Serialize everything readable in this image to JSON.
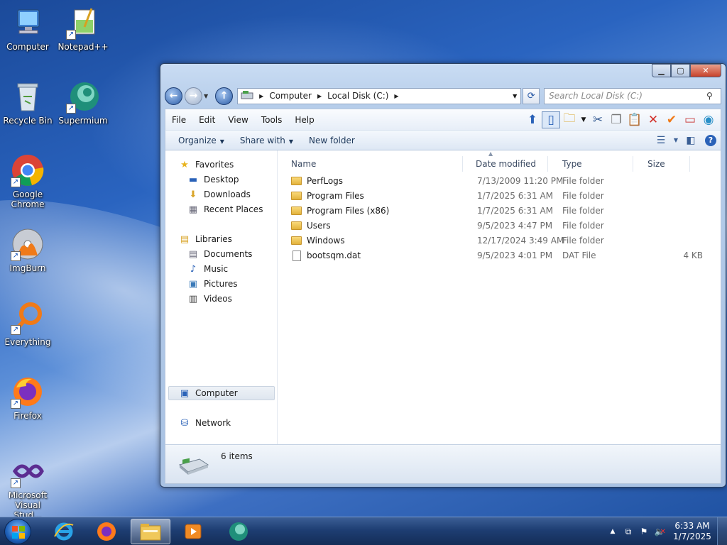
{
  "desktop": {
    "icons": [
      {
        "label": "Computer",
        "icon": "computer-icon"
      },
      {
        "label": "Notepad++",
        "icon": "notepadpp-icon"
      },
      {
        "label": "Recycle Bin",
        "icon": "recycle-bin-icon"
      },
      {
        "label": "Supermium",
        "icon": "supermium-icon"
      },
      {
        "label": "Google Chrome",
        "icon": "chrome-icon"
      },
      {
        "label": "ImgBurn",
        "icon": "imgburn-icon"
      },
      {
        "label": "Everything",
        "icon": "everything-icon"
      },
      {
        "label": "Firefox",
        "icon": "firefox-icon"
      },
      {
        "label": "Microsoft Visual Stud...",
        "icon": "visual-studio-icon"
      }
    ]
  },
  "explorer": {
    "address": {
      "crumbs": [
        "Computer",
        "Local Disk (C:)"
      ]
    },
    "search": {
      "placeholder": "Search Local Disk (C:)"
    },
    "menu": [
      "File",
      "Edit",
      "View",
      "Tools",
      "Help"
    ],
    "commands": {
      "organize": "Organize",
      "share_with": "Share with",
      "new_folder": "New folder"
    },
    "nav": {
      "favorites": "Favorites",
      "favorites_items": [
        "Desktop",
        "Downloads",
        "Recent Places"
      ],
      "libraries": "Libraries",
      "libraries_items": [
        "Documents",
        "Music",
        "Pictures",
        "Videos"
      ],
      "computer": "Computer",
      "network": "Network"
    },
    "columns": {
      "name": "Name",
      "date": "Date modified",
      "type": "Type",
      "size": "Size"
    },
    "files": [
      {
        "name": "PerfLogs",
        "date": "7/13/2009 11:20 PM",
        "type": "File folder",
        "size": "",
        "kind": "folder"
      },
      {
        "name": "Program Files",
        "date": "1/7/2025 6:31 AM",
        "type": "File folder",
        "size": "",
        "kind": "folder"
      },
      {
        "name": "Program Files (x86)",
        "date": "1/7/2025 6:31 AM",
        "type": "File folder",
        "size": "",
        "kind": "folder"
      },
      {
        "name": "Users",
        "date": "9/5/2023 4:47 PM",
        "type": "File folder",
        "size": "",
        "kind": "folder"
      },
      {
        "name": "Windows",
        "date": "12/17/2024 3:49 AM",
        "type": "File folder",
        "size": "",
        "kind": "folder"
      },
      {
        "name": "bootsqm.dat",
        "date": "9/5/2023 4:01 PM",
        "type": "DAT File",
        "size": "4 KB",
        "kind": "file"
      }
    ],
    "details": {
      "items_count": "6 items"
    }
  },
  "taskbar": {
    "clock": {
      "time": "6:33 AM",
      "date": "1/7/2025"
    }
  },
  "colors": {
    "window_frame": "#b6cdea",
    "taskbar": "#1e3e73",
    "folder": "#f0c85a"
  }
}
